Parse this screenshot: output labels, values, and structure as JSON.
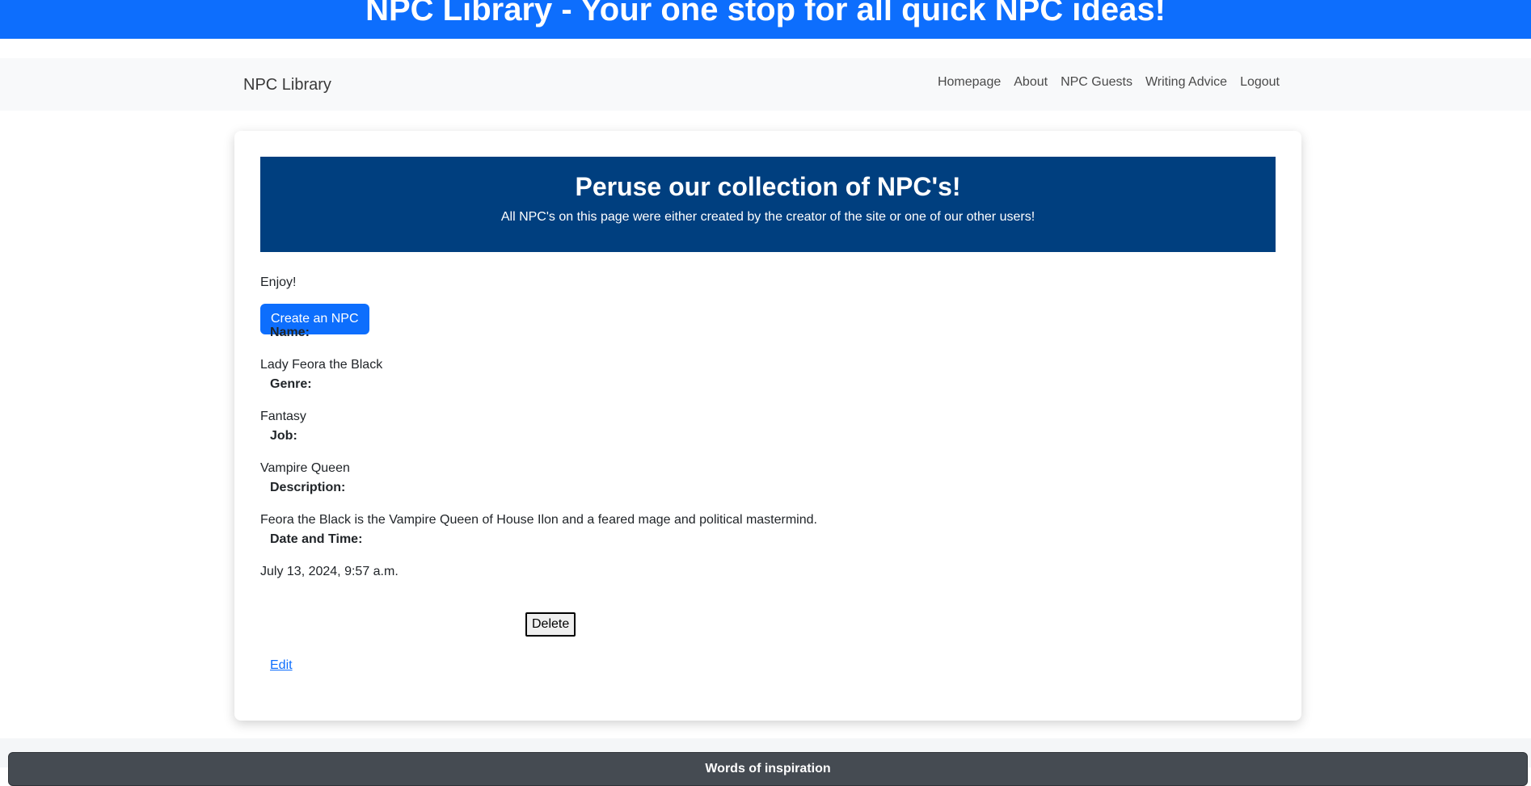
{
  "banner": {
    "title": "NPC Library - Your one stop for all quick NPC ideas!"
  },
  "navbar": {
    "brand": "NPC Library",
    "links": [
      {
        "label": "Homepage"
      },
      {
        "label": "About"
      },
      {
        "label": "NPC Guests"
      },
      {
        "label": "Writing Advice"
      },
      {
        "label": "Logout"
      }
    ]
  },
  "hero": {
    "heading": "Peruse our collection of NPC's!",
    "subheading": "All NPC's on this page were either created by the creator of the site or one of our other users!"
  },
  "main": {
    "intro": "Enjoy!",
    "create_button": "Create an NPC"
  },
  "npc": {
    "name_label": "Name:",
    "name": "Lady Feora the Black",
    "genre_label": "Genre:",
    "genre": "Fantasy",
    "job_label": "Job:",
    "job": "Vampire Queen",
    "description_label": "Description:",
    "description": "Feora the Black is the Vampire Queen of House Ilon and a feared mage and political mastermind.",
    "datetime_label": "Date and Time:",
    "datetime": "July 13, 2024, 9:57 a.m.",
    "delete_button": "Delete",
    "edit_link": "Edit"
  },
  "footer": {
    "title": "Words of inspiration"
  },
  "colors": {
    "banner": "#0d6efd",
    "hero": "#003f7f",
    "primary_button": "#0d6efd",
    "navbar_bg": "#f8f9fa",
    "footer_bg": "#454b52"
  }
}
